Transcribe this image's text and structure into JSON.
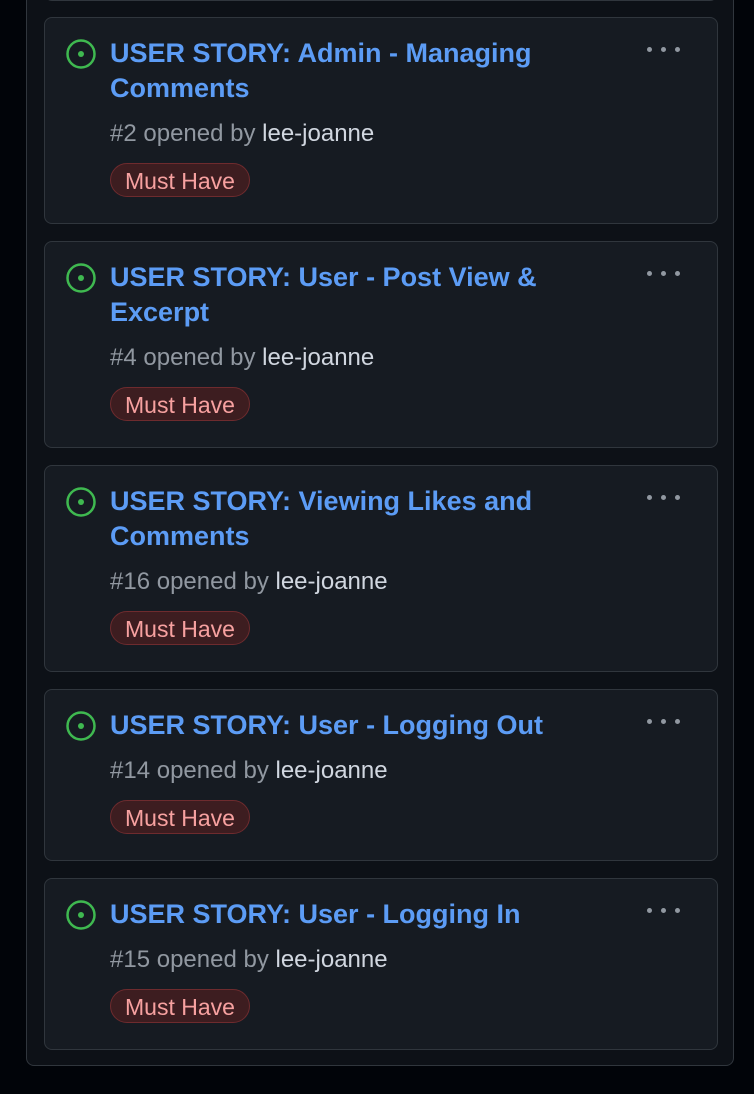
{
  "colors": {
    "page_bg": "#010409",
    "column_bg": "#0d1117",
    "card_bg": "#161b22",
    "border": "#30363d",
    "title": "#5c9cf5",
    "open_icon": "#3fb950",
    "muted_text": "#9198a1",
    "author_text": "#d1d7e0",
    "label_bg": "#3d1d20",
    "label_border": "#6e2b2e",
    "label_text": "#f7a1a0"
  },
  "cards": [
    {
      "status_icon": "issue-opened-icon",
      "title": "USER STORY: Admin - Managing Comments",
      "number": "#2",
      "opened_by_text": "opened by",
      "author": "lee-joanne",
      "label": "Must Have"
    },
    {
      "status_icon": "issue-opened-icon",
      "title": "USER STORY: User - Post View & Excerpt",
      "number": "#4",
      "opened_by_text": "opened by",
      "author": "lee-joanne",
      "label": "Must Have"
    },
    {
      "status_icon": "issue-opened-icon",
      "title": "USER STORY: Viewing Likes and Comments",
      "number": "#16",
      "opened_by_text": "opened by",
      "author": "lee-joanne",
      "label": "Must Have"
    },
    {
      "status_icon": "issue-opened-icon",
      "title": "USER STORY: User - Logging Out",
      "number": "#14",
      "opened_by_text": "opened by",
      "author": "lee-joanne",
      "label": "Must Have"
    },
    {
      "status_icon": "issue-opened-icon",
      "title": "USER STORY: User - Logging In",
      "number": "#15",
      "opened_by_text": "opened by",
      "author": "lee-joanne",
      "label": "Must Have"
    }
  ]
}
